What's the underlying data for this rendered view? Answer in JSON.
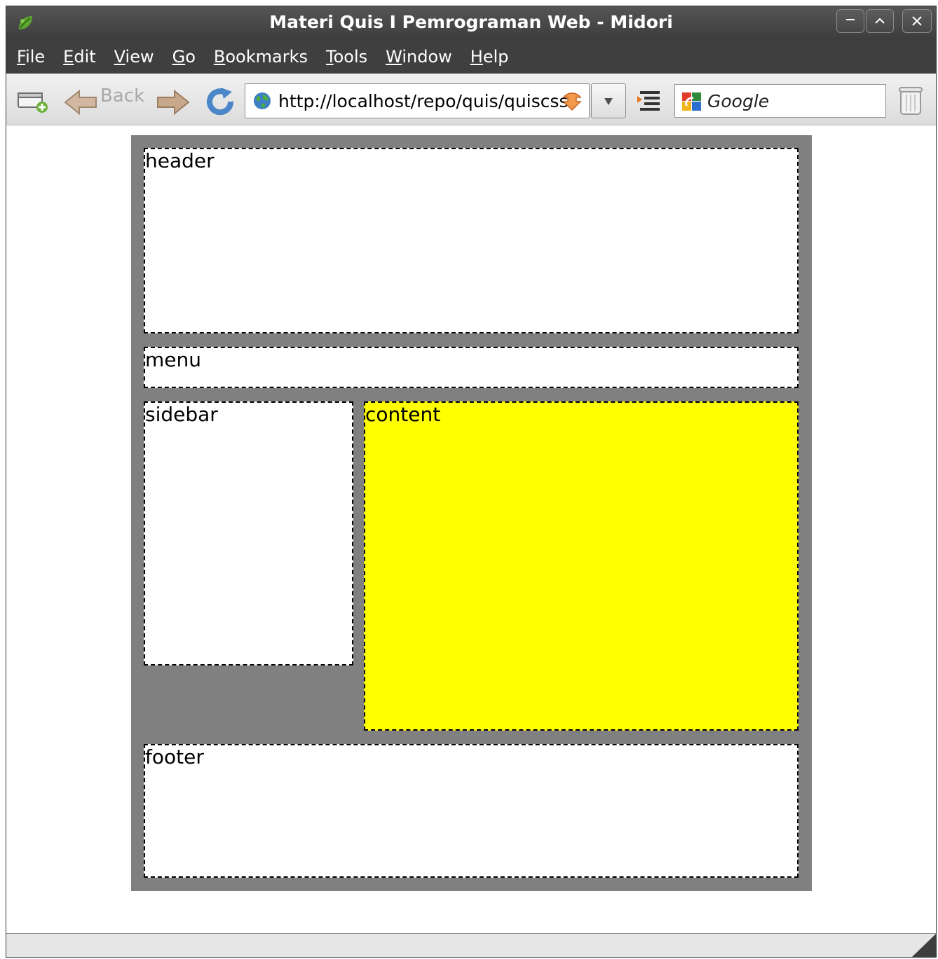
{
  "window": {
    "title": "Materi Quis I Pemrograman Web - Midori",
    "app_icon": "midori-leaf-icon"
  },
  "menu": [
    {
      "mnemonic": "F",
      "rest": "ile"
    },
    {
      "mnemonic": "E",
      "rest": "dit"
    },
    {
      "mnemonic": "V",
      "rest": "iew"
    },
    {
      "mnemonic": "G",
      "rest": "o"
    },
    {
      "mnemonic": "B",
      "rest": "ookmarks"
    },
    {
      "mnemonic": "T",
      "rest": "ools"
    },
    {
      "mnemonic": "W",
      "rest": "indow"
    },
    {
      "mnemonic": "H",
      "rest": "elp"
    }
  ],
  "toolbar": {
    "back_label": "Back",
    "url": "http://localhost/repo/quis/quiscss",
    "search_placeholder": "Google"
  },
  "page": {
    "header_label": "header",
    "menu_label": "menu",
    "sidebar_label": "sidebar",
    "content_label": "content",
    "footer_label": "footer"
  },
  "colors": {
    "container": "#808080",
    "content": "#ffff00",
    "boxes": "#ffffff"
  }
}
